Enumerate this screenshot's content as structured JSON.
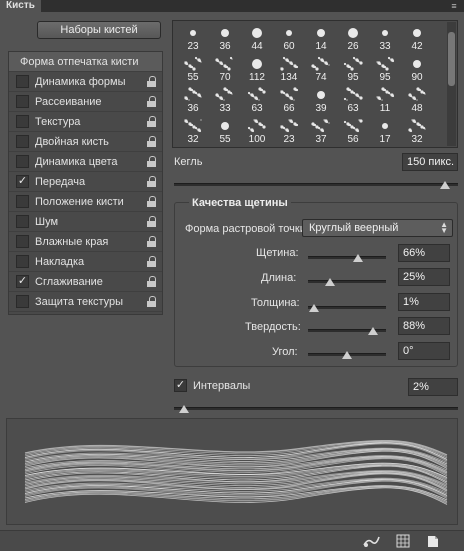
{
  "panel": {
    "tab_label": "Кисть",
    "menu_icon": "panel-menu-icon"
  },
  "presets_button": "Наборы кистей",
  "brush_settings_header": "Форма отпечатка кисти",
  "settings_list": [
    {
      "label": "Динамика формы",
      "checked": false,
      "locked": true
    },
    {
      "label": "Рассеивание",
      "checked": false,
      "locked": true
    },
    {
      "label": "Текстура",
      "checked": false,
      "locked": true
    },
    {
      "label": "Двойная кисть",
      "checked": false,
      "locked": true
    },
    {
      "label": "Динамика цвета",
      "checked": false,
      "locked": true
    },
    {
      "label": "Передача",
      "checked": true,
      "locked": true
    },
    {
      "label": "Положение кисти",
      "checked": false,
      "locked": true
    },
    {
      "label": "Шум",
      "checked": false,
      "locked": true
    },
    {
      "label": "Влажные края",
      "checked": false,
      "locked": true
    },
    {
      "label": "Накладка",
      "checked": false,
      "locked": true
    },
    {
      "label": "Сглаживание",
      "checked": true,
      "locked": true
    },
    {
      "label": "Защита текстуры",
      "checked": false,
      "locked": true
    }
  ],
  "brush_tips": [
    [
      "23",
      "36",
      "44",
      "60",
      "14",
      "26",
      "33",
      "42"
    ],
    [
      "55",
      "70",
      "112",
      "134",
      "74",
      "95",
      "95",
      "90"
    ],
    [
      "36",
      "33",
      "63",
      "66",
      "39",
      "63",
      "11",
      "48"
    ],
    [
      "32",
      "55",
      "100",
      "23",
      "37",
      "56",
      "17",
      "32"
    ]
  ],
  "brush_size": {
    "label": "Кегль",
    "value": "150 пикс."
  },
  "bristle_qualities": {
    "title": "Качества щетины",
    "shape_label": "Форма растровой точки:",
    "shape_value": "Круглый веерный",
    "params": [
      {
        "label": "Щетина:",
        "value": "66%",
        "level": 0.66
      },
      {
        "label": "Длина:",
        "value": "25%",
        "level": 0.25
      },
      {
        "label": "Толщина:",
        "value": "1%",
        "level": 0.01
      },
      {
        "label": "Твердость:",
        "value": "88%",
        "level": 0.88
      },
      {
        "label": "Угол:",
        "value": "0°",
        "level": 0.5
      }
    ]
  },
  "spacing": {
    "label": "Интервалы",
    "checked": true,
    "value": "2%",
    "level": 0.02
  },
  "size_slider_level": 0.97,
  "bottom_icons": [
    "bristle-preview-icon",
    "grid-icon",
    "new-preset-icon"
  ]
}
